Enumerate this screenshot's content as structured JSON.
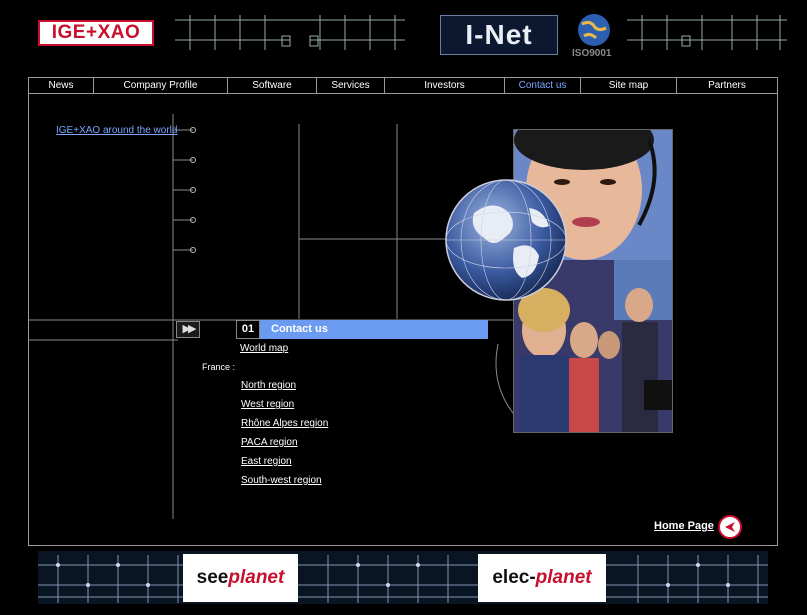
{
  "header": {
    "logo_text": "IGE+XAO",
    "ionet_text": "I-Net",
    "iso_text": "ISO9001"
  },
  "nav": {
    "items": [
      {
        "label": "News"
      },
      {
        "label": "Company Profile"
      },
      {
        "label": "Software"
      },
      {
        "label": "Services"
      },
      {
        "label": "Investors"
      },
      {
        "label": "Contact us"
      },
      {
        "label": "Site map"
      },
      {
        "label": "Partners"
      }
    ],
    "active": "Contact us"
  },
  "side": {
    "world_link": "IGE+XAO around the world"
  },
  "section": {
    "number": "01",
    "title": "Contact us",
    "arrows": "▶▶"
  },
  "links": {
    "world_map": "World map",
    "france_label": "France :",
    "regions": [
      "North region",
      "West region",
      "Rhône Alpes region",
      "PACA region",
      "East region",
      "South-west region"
    ]
  },
  "home": {
    "label": "Home Page"
  },
  "footer": {
    "see_brand_a": "see",
    "see_brand_b": "planet",
    "elec_brand_a": "elec-",
    "elec_brand_b": "planet"
  },
  "colors": {
    "accent_blue": "#6b9bf0",
    "link_blue": "#7aa6ff",
    "brand_red": "#c8102e"
  }
}
